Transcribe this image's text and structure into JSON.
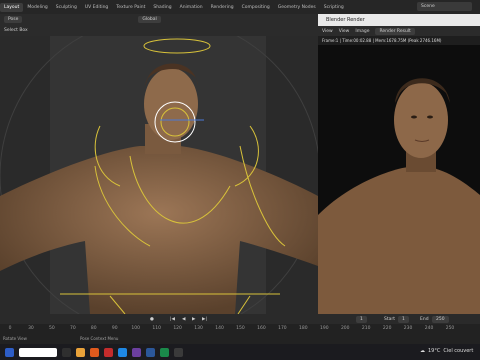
{
  "workspace_tabs": [
    "Layout",
    "Modeling",
    "Sculpting",
    "UV Editing",
    "Texture Paint",
    "Shading",
    "Animation",
    "Rendering",
    "Compositing",
    "Geometry Nodes",
    "Scripting"
  ],
  "active_tab": "Layout",
  "scene_label": "Scene",
  "viewport": {
    "mode_label": "Pose",
    "select_label": "Select Box",
    "orientation_label": "Global"
  },
  "render_window": {
    "title": "Blender Render",
    "menu": [
      "View",
      "View",
      "Image"
    ],
    "result_label": "Render Result",
    "info": "Frame:1 | Time:00:02.88 | Mem:1678.75M (Peak 2746.16M)"
  },
  "timeline": {
    "ticks": [
      "0",
      "30",
      "50",
      "70",
      "80",
      "90",
      "100",
      "110",
      "120",
      "130",
      "140",
      "150",
      "160",
      "170",
      "180",
      "190",
      "200",
      "210",
      "220",
      "230",
      "240",
      "250"
    ],
    "current_frame": "1",
    "start_label": "Start",
    "start_value": "1",
    "end_label": "End",
    "end_value": "250",
    "status_text": "Rotate View",
    "context_text": "Pose Context Menu"
  },
  "taskbar": {
    "weather_temp": "19°C",
    "weather_desc": "Ciel couvert"
  },
  "colors": {
    "rig": "#d8c23a",
    "skin": "#8a6a4a",
    "accent": "#4772b3"
  }
}
